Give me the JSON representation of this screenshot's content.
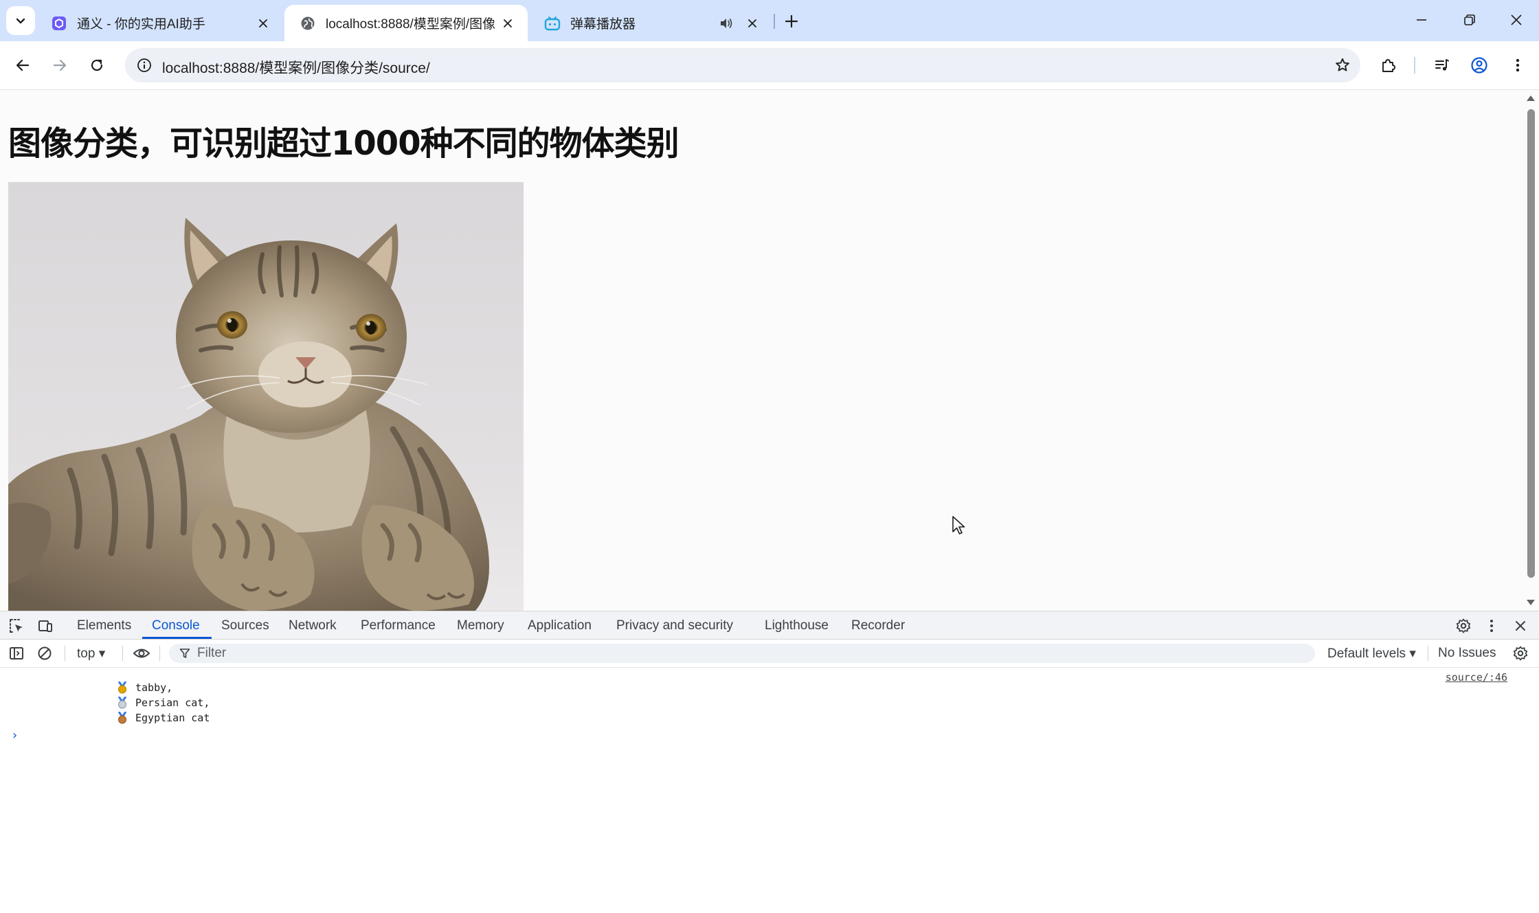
{
  "browser": {
    "tabs": [
      {
        "title": "通义 - 你的实用AI助手",
        "active": false
      },
      {
        "title": "localhost:8888/模型案例/图像",
        "active": true
      },
      {
        "title": "弹幕播放器",
        "active": false
      }
    ],
    "url": "localhost:8888/模型案例/图像分类/source/"
  },
  "page": {
    "title": "图像分类，可识别超过1000种不同的物体类别",
    "image_alt": "tabby cat photo"
  },
  "devtools": {
    "tabs": [
      "Elements",
      "Console",
      "Sources",
      "Network",
      "Performance",
      "Memory",
      "Application",
      "Privacy and security",
      "Lighthouse",
      "Recorder"
    ],
    "active_tab": "Console",
    "context": "top ▾",
    "filter_placeholder": "Filter",
    "levels": "Default levels ▾",
    "issues": "No Issues",
    "source_link": "source/:46",
    "log_lines": [
      "tabby,",
      "Persian cat,",
      "Egyptian cat"
    ],
    "prompt": "›"
  },
  "colors": {
    "tabstrip": "#d3e3fd",
    "accent": "#0b57d0",
    "gold": "#e0a800",
    "silver": "#a9b4bf",
    "bronze": "#c27c3a"
  }
}
